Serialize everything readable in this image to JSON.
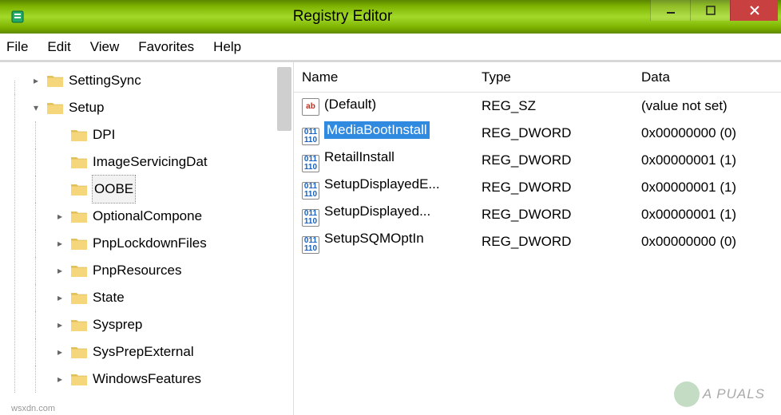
{
  "window": {
    "title": "Registry Editor"
  },
  "menu": {
    "file": "File",
    "edit": "Edit",
    "view": "View",
    "favorites": "Favorites",
    "help": "Help"
  },
  "tree": {
    "root": [
      {
        "label": "SettingSync",
        "expander": "closed"
      },
      {
        "label": "Setup",
        "expander": "open",
        "children": [
          {
            "label": "DPI",
            "expander": "none"
          },
          {
            "label": "ImageServicingDat",
            "expander": "none"
          },
          {
            "label": "OOBE",
            "expander": "none",
            "selected": true
          },
          {
            "label": "OptionalCompone",
            "expander": "closed"
          },
          {
            "label": "PnpLockdownFiles",
            "expander": "closed"
          },
          {
            "label": "PnpResources",
            "expander": "closed"
          },
          {
            "label": "State",
            "expander": "closed"
          },
          {
            "label": "Sysprep",
            "expander": "closed"
          },
          {
            "label": "SysPrepExternal",
            "expander": "closed"
          },
          {
            "label": "WindowsFeatures",
            "expander": "closed"
          }
        ]
      }
    ]
  },
  "list": {
    "headers": {
      "name": "Name",
      "type": "Type",
      "data": "Data"
    },
    "rows": [
      {
        "icon": "sz",
        "name": "(Default)",
        "type": "REG_SZ",
        "data": "(value not set)",
        "selected": false
      },
      {
        "icon": "dw",
        "name": "MediaBootInstall",
        "type": "REG_DWORD",
        "data": "0x00000000 (0)",
        "selected": true
      },
      {
        "icon": "dw",
        "name": "RetailInstall",
        "type": "REG_DWORD",
        "data": "0x00000001 (1)",
        "selected": false
      },
      {
        "icon": "dw",
        "name": "SetupDisplayedE...",
        "type": "REG_DWORD",
        "data": "0x00000001 (1)",
        "selected": false
      },
      {
        "icon": "dw",
        "name": "SetupDisplayed...",
        "type": "REG_DWORD",
        "data": "0x00000001 (1)",
        "selected": false
      },
      {
        "icon": "dw",
        "name": "SetupSQMOptIn",
        "type": "REG_DWORD",
        "data": "0x00000000 (0)",
        "selected": false
      }
    ]
  },
  "watermark": {
    "text": "A  PUALS"
  },
  "source": {
    "text": "wsxdn.com"
  },
  "icons": {
    "sz": "ab",
    "dw": "011\n110"
  }
}
